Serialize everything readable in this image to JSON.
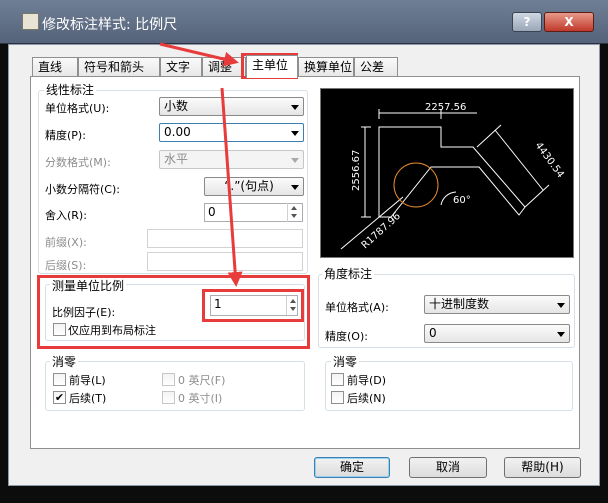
{
  "window": {
    "title": "修改标注样式: 比例尺",
    "help": "?",
    "close": "X"
  },
  "tabs": [
    "直线",
    "符号和箭头",
    "文字",
    "调整",
    "主单位",
    "换算单位",
    "公差"
  ],
  "linear": {
    "title": "线性标注",
    "unit_format_label": "单位格式(U):",
    "unit_format_value": "小数",
    "precision_label": "精度(P):",
    "precision_value": "0.00",
    "fraction_format_label": "分数格式(M):",
    "fraction_format_value": "水平",
    "decimal_sep_label": "小数分隔符(C):",
    "decimal_sep_value": "“.”(句点)",
    "round_label": "舍入(R):",
    "round_value": "0",
    "prefix_label": "前缀(X):",
    "suffix_label": "后缀(S):"
  },
  "scale": {
    "title": "测量单位比例",
    "factor_label": "比例因子(E):",
    "factor_value": "1",
    "layout_only_label": "仅应用到布局标注"
  },
  "zero_linear": {
    "title": "消零",
    "leading_label": "前导(L)",
    "trailing_label": "后续(T)",
    "feet_label": "0 英尺(F)",
    "inches_label": "0 英寸(I)"
  },
  "preview": {
    "dim_top": "2257.56",
    "dim_left": "2556.67",
    "dim_right": "4430.54",
    "dim_radius": "R1787.96",
    "dim_angle": "60°"
  },
  "angular": {
    "title": "角度标注",
    "unit_format_label": "单位格式(A):",
    "unit_format_value": "十进制度数",
    "precision_label": "精度(O):",
    "precision_value": "0"
  },
  "zero_angular": {
    "title": "消零",
    "leading_label": "前导(D)",
    "trailing_label": "后续(N)"
  },
  "buttons": {
    "ok": "确定",
    "cancel": "取消",
    "help": "帮助(H)"
  },
  "annotation_color": "#e83c3c"
}
